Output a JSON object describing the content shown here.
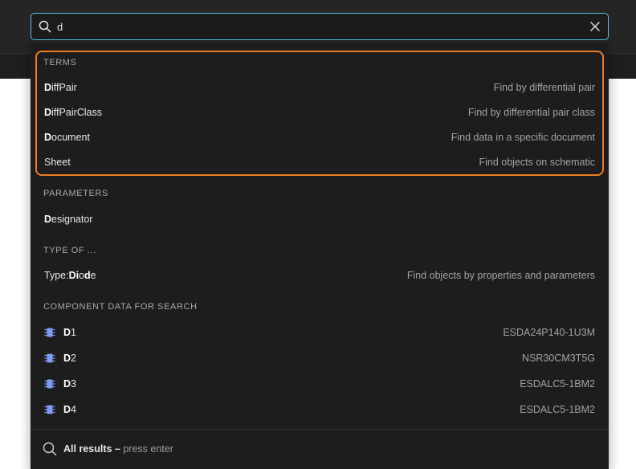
{
  "search": {
    "value": "d",
    "placeholder": ""
  },
  "sections": {
    "terms": "TERMS",
    "parameters": "PARAMETERS",
    "type_of": "TYPE OF ...",
    "component_data": "COMPONENT DATA FOR SEARCH"
  },
  "terms": [
    {
      "match": "D",
      "rest": "iffPair",
      "desc": "Find by differential pair"
    },
    {
      "match": "D",
      "rest": "iffPairClass",
      "desc": "Find by differential pair class"
    },
    {
      "match": "D",
      "rest": "ocument",
      "desc": "Find data in a specific document"
    },
    {
      "match": "",
      "rest": "Sheet",
      "desc": "Find objects on schematic"
    }
  ],
  "parameters": [
    {
      "match": "D",
      "rest": "esignator"
    }
  ],
  "type_of": [
    {
      "prefix": "Type:",
      "m1": "Di",
      "mid": "o",
      "m2": "d",
      "rest": "e",
      "desc": "Find objects by properties and parameters"
    }
  ],
  "components": [
    {
      "match": "D",
      "rest": "1",
      "desc": "ESDA24P140-1U3M",
      "icon": "chip-icon"
    },
    {
      "match": "D",
      "rest": "2",
      "desc": "NSR30CM3T5G",
      "icon": "chip-icon"
    },
    {
      "match": "D",
      "rest": "3",
      "desc": "ESDALC5-1BM2",
      "icon": "chip-icon"
    },
    {
      "match": "D",
      "rest": "4",
      "desc": "ESDALC5-1BM2",
      "icon": "chip-icon"
    }
  ],
  "footer": {
    "strong": "All results –",
    "hint": " press enter"
  },
  "colors": {
    "focus_border": "#58c3e2",
    "highlight_border": "#ef7c1f",
    "chip_icon": "#7f9cf5"
  }
}
